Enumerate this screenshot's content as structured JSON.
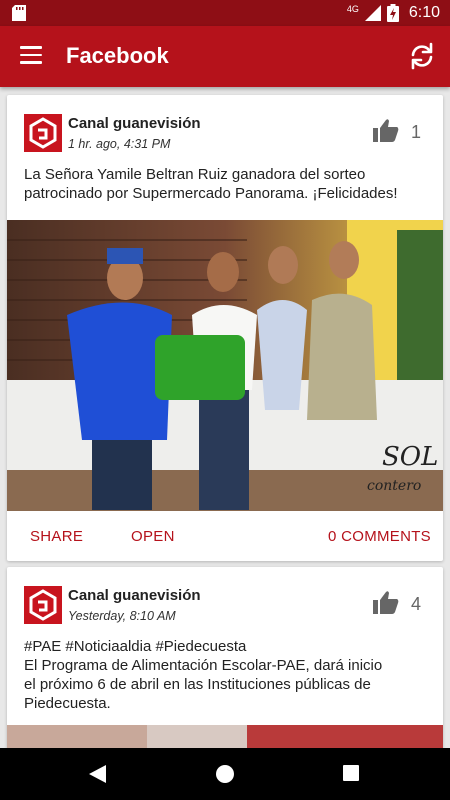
{
  "status_bar": {
    "time": "6:10",
    "network": "4G"
  },
  "app_bar": {
    "title": "Facebook"
  },
  "posts": [
    {
      "author": "Canal guanevisión",
      "time": "1 hr. ago, 4:31 PM",
      "likes": "1",
      "text": "La Señora Yamile Beltran Ruiz ganadora del sorteo patrocinado por Supermercado Panorama. ¡Felicidades!",
      "watermark_text": "EL SOL del CONTERO",
      "actions": {
        "share": "SHARE",
        "open": "OPEN",
        "comments": "0 COMMENTS"
      }
    },
    {
      "author": "Canal guanevisión",
      "time": "Yesterday, 8:10 AM",
      "likes": "4",
      "text_lines": [
        "#PAE #Noticiaaldia #Piedecuesta",
        "El Programa de Alimentación Escolar-PAE, dará inicio",
        "el próximo 6 de abril en las Instituciones públicas de",
        "Piedecuesta."
      ]
    }
  ],
  "colors": {
    "primary": "#b5121b",
    "status_bar": "#8e0e15",
    "accent_text": "#b5121b"
  }
}
